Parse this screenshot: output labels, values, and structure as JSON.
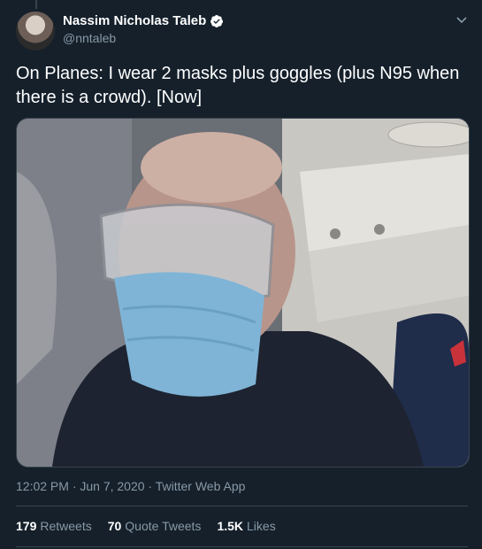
{
  "author": {
    "name": "Nassim Nicholas Taleb",
    "handle": "@nntaleb"
  },
  "tweet": {
    "text": "On Planes: I wear 2 masks plus goggles (plus N95 when there is a crowd).  [Now]",
    "meta": "12:02 PM · Jun 7, 2020 · Twitter Web App"
  },
  "stats": {
    "retweets_count": "179",
    "retweets_label": "Retweets",
    "quotes_count": "70",
    "quotes_label": "Quote Tweets",
    "likes_count": "1.5K",
    "likes_label": "Likes"
  },
  "colors": {
    "background": "#15202b",
    "secondary_text": "#8899a6",
    "verified": "#ffffff"
  }
}
